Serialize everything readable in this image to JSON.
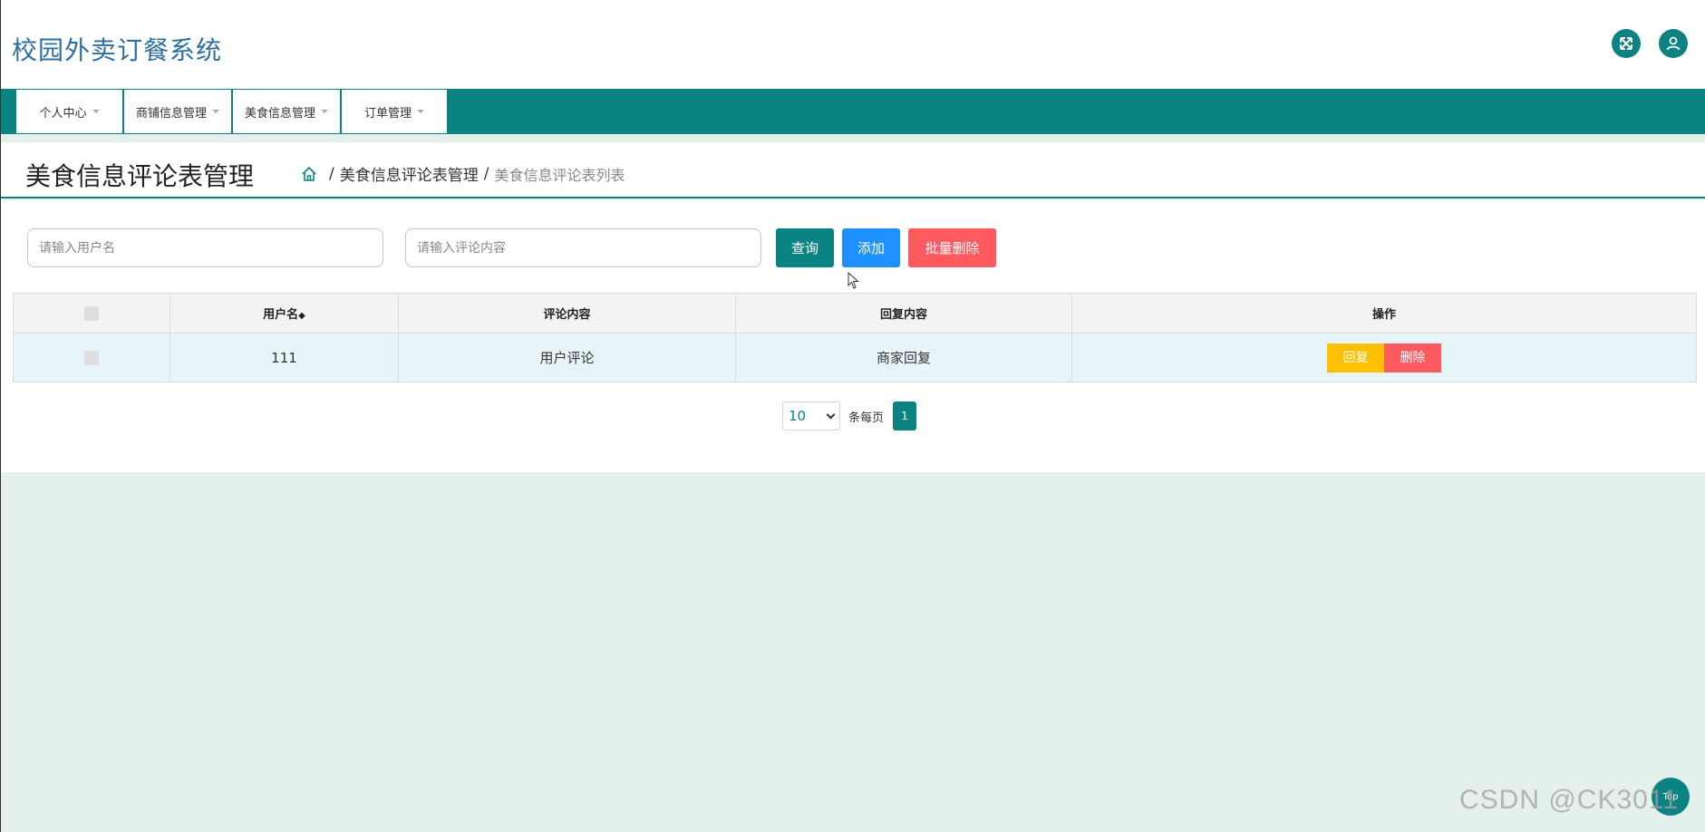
{
  "app": {
    "title": "校园外卖订餐系统"
  },
  "header": {
    "fullscreen_icon": "fullscreen-icon",
    "user_icon": "user-icon"
  },
  "nav": {
    "items": [
      {
        "label": "个人中心"
      },
      {
        "label": "商铺信息管理"
      },
      {
        "label": "美食信息管理"
      },
      {
        "label": "订单管理"
      }
    ]
  },
  "page": {
    "title": "美食信息评论表管理",
    "breadcrumb": {
      "home_icon": "home-icon",
      "sep": "/",
      "section": "美食信息评论表管理",
      "current": "美食信息评论表列表"
    }
  },
  "search": {
    "username_placeholder": "请输入用户名",
    "content_placeholder": "请输入评论内容",
    "query_label": "查询",
    "add_label": "添加",
    "batch_delete_label": "批量删除"
  },
  "table": {
    "headers": {
      "username": "用户名",
      "sort_icon": "◆",
      "content": "评论内容",
      "reply": "回复内容",
      "actions": "操作"
    },
    "rows": [
      {
        "username": "111",
        "content": "用户评论",
        "reply": "商家回复",
        "reply_btn": "回复",
        "delete_btn": "删除"
      }
    ]
  },
  "pagination": {
    "page_size": "10",
    "per_page_label": "条每页",
    "current_page": "1"
  },
  "footer": {
    "top_label": "Top",
    "watermark": "CSDN @CK3011"
  },
  "colors": {
    "primary": "#0c8383",
    "add": "#1e90ff",
    "danger": "#ff5a5f",
    "warning": "#ffc000"
  }
}
